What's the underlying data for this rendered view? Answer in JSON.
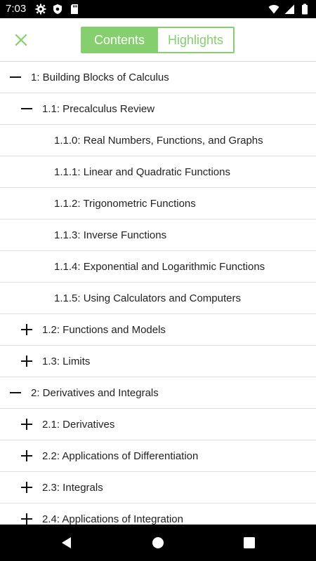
{
  "status_bar": {
    "time": "7:03",
    "left_icons": [
      "gear-icon",
      "shield-icon",
      "sd-card-icon"
    ],
    "right_icons": [
      "wifi-icon",
      "signal-icon",
      "battery-icon"
    ]
  },
  "header": {
    "close_icon": "close-icon",
    "tabs": [
      {
        "label": "Contents",
        "active": true
      },
      {
        "label": "Highlights",
        "active": false
      }
    ],
    "accent_color": "#85cf6f"
  },
  "toc": {
    "items": [
      {
        "label": "1: Building Blocks of Calculus",
        "level": 0,
        "state": "expanded"
      },
      {
        "label": "1.1: Precalculus Review",
        "level": 1,
        "state": "expanded"
      },
      {
        "label": "1.1.0: Real Numbers, Functions, and Graphs",
        "level": 2,
        "state": "leaf"
      },
      {
        "label": "1.1.1: Linear and Quadratic Functions",
        "level": 2,
        "state": "leaf"
      },
      {
        "label": "1.1.2: Trigonometric Functions",
        "level": 2,
        "state": "leaf"
      },
      {
        "label": "1.1.3: Inverse Functions",
        "level": 2,
        "state": "leaf"
      },
      {
        "label": "1.1.4: Exponential and Logarithmic Functions",
        "level": 2,
        "state": "leaf"
      },
      {
        "label": "1.1.5: Using Calculators and Computers",
        "level": 2,
        "state": "leaf"
      },
      {
        "label": "1.2: Functions and Models",
        "level": 1,
        "state": "collapsed"
      },
      {
        "label": "1.3: Limits",
        "level": 1,
        "state": "collapsed"
      },
      {
        "label": "2: Derivatives and Integrals",
        "level": 0,
        "state": "expanded"
      },
      {
        "label": "2.1: Derivatives",
        "level": 1,
        "state": "collapsed"
      },
      {
        "label": "2.2: Applications of Differentiation",
        "level": 1,
        "state": "collapsed"
      },
      {
        "label": "2.3: Integrals",
        "level": 1,
        "state": "collapsed"
      },
      {
        "label": "2.4: Applications of Integration",
        "level": 1,
        "state": "collapsed"
      }
    ]
  },
  "nav_bar": {
    "buttons": [
      "back-icon",
      "home-icon",
      "recents-icon"
    ]
  }
}
